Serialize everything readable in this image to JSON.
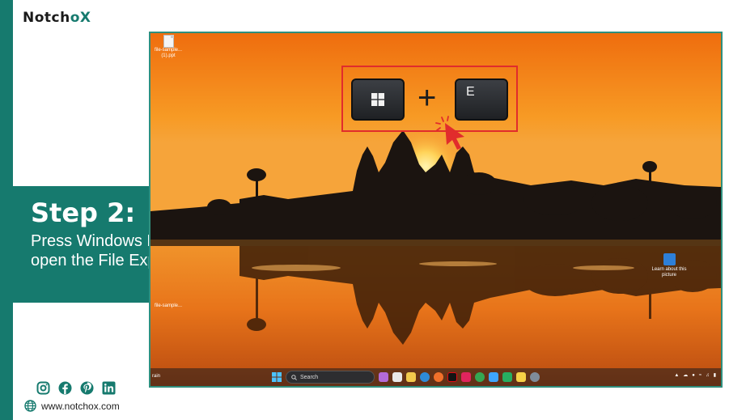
{
  "brand": {
    "name_part1": "Notch",
    "name_o": "o",
    "name_x": "X"
  },
  "step": {
    "title": "Step 2:",
    "description": "Press Windows Key + E to open the File Explorer"
  },
  "footer": {
    "socials": [
      "instagram-icon",
      "facebook-icon",
      "pinterest-icon",
      "linkedin-icon"
    ],
    "website": "www.notchox.com"
  },
  "screen": {
    "desktop_icons": [
      {
        "label": "file-sample...\n(1).ppt"
      },
      {
        "label": "file-sample..."
      }
    ],
    "keys": {
      "win_icon": "windows-logo-icon",
      "plus": "+",
      "e_label": "E"
    },
    "learn_label": "Learn about this picture",
    "taskbar": {
      "weather_label": "rain",
      "search_label": "Search"
    }
  },
  "colors": {
    "brand": "#167a6e",
    "highlight": "#e12c2c",
    "sky": "#f07a14"
  }
}
